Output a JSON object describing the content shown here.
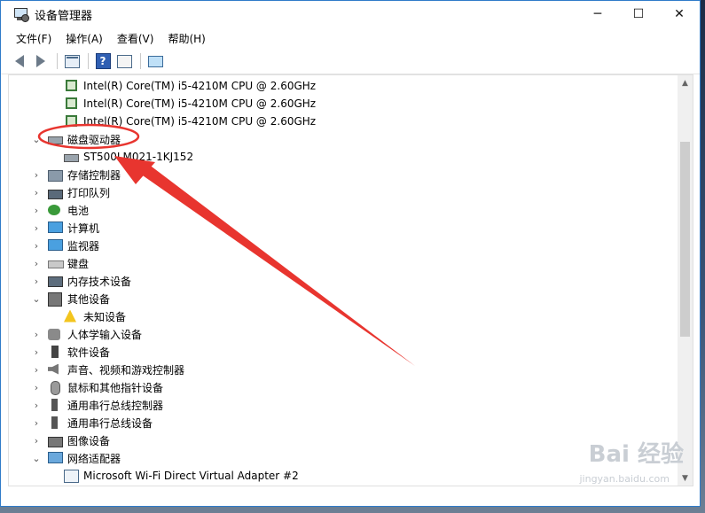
{
  "window": {
    "title": "设备管理器",
    "minimize": "─",
    "maximize": "☐",
    "close": "✕"
  },
  "menu": [
    "文件(F)",
    "操作(A)",
    "查看(V)",
    "帮助(H)"
  ],
  "tree": [
    {
      "label": "Intel(R) Core(TM) i5-4210M CPU @ 2.60GHz",
      "level": 1,
      "icon": "cpu-icon"
    },
    {
      "label": "Intel(R) Core(TM) i5-4210M CPU @ 2.60GHz",
      "level": 1,
      "icon": "cpu-icon"
    },
    {
      "label": "Intel(R) Core(TM) i5-4210M CPU @ 2.60GHz",
      "level": 1,
      "icon": "cpu-icon"
    },
    {
      "label": "磁盘驱动器",
      "level": 0,
      "expanded": true,
      "icon": "disk-drive-icon"
    },
    {
      "label": "ST500LM021-1KJ152",
      "level": 1,
      "icon": "disk-icon"
    },
    {
      "label": "存储控制器",
      "level": 0,
      "icon": "storage-controller-icon"
    },
    {
      "label": "打印队列",
      "level": 0,
      "icon": "printer-icon"
    },
    {
      "label": "电池",
      "level": 0,
      "icon": "battery-icon"
    },
    {
      "label": "计算机",
      "level": 0,
      "icon": "computer-icon"
    },
    {
      "label": "监视器",
      "level": 0,
      "icon": "monitor-icon"
    },
    {
      "label": "键盘",
      "level": 0,
      "icon": "keyboard-icon"
    },
    {
      "label": "内存技术设备",
      "level": 0,
      "icon": "memory-icon"
    },
    {
      "label": "其他设备",
      "level": 0,
      "expanded": true,
      "icon": "other-devices-icon"
    },
    {
      "label": "未知设备",
      "level": 1,
      "icon": "unknown-device-warning-icon"
    },
    {
      "label": "人体学输入设备",
      "level": 0,
      "icon": "hid-icon"
    },
    {
      "label": "软件设备",
      "level": 0,
      "icon": "software-device-icon"
    },
    {
      "label": "声音、视频和游戏控制器",
      "level": 0,
      "icon": "sound-icon"
    },
    {
      "label": "鼠标和其他指针设备",
      "level": 0,
      "icon": "mouse-icon"
    },
    {
      "label": "通用串行总线控制器",
      "level": 0,
      "icon": "usb-icon"
    },
    {
      "label": "通用串行总线设备",
      "level": 0,
      "icon": "usb-icon"
    },
    {
      "label": "图像设备",
      "level": 0,
      "icon": "camera-icon"
    },
    {
      "label": "网络适配器",
      "level": 0,
      "expanded": true,
      "icon": "network-icon"
    },
    {
      "label": "Microsoft Wi-Fi Direct Virtual Adapter #2",
      "level": 1,
      "icon": "network-adapter-icon"
    }
  ],
  "watermark": {
    "text": "Bai 经验",
    "sub": "jingyan.baidu.com"
  },
  "colors": {
    "annotation": "#e8352f",
    "accent": "#2f7bc9"
  }
}
